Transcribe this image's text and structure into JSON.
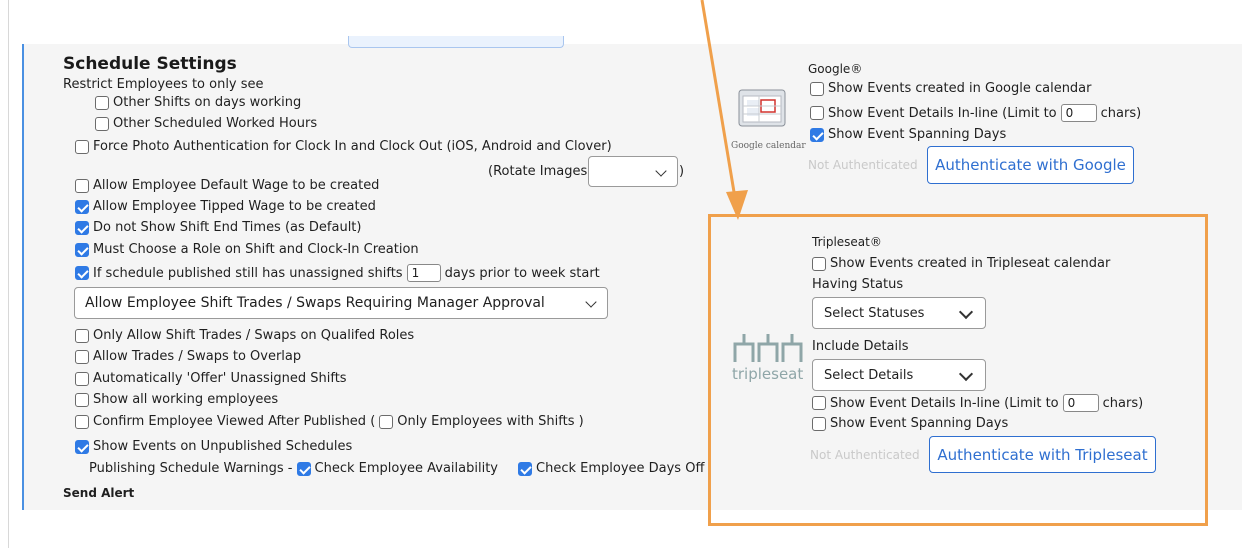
{
  "schedule": {
    "title": "Schedule Settings",
    "restrict_label": "Restrict Employees to only see",
    "other_shifts": "Other Shifts on days working",
    "other_hours": "Other Scheduled Worked Hours",
    "force_photo": "Force Photo Authentication for Clock In and Clock Out (iOS, Android and Clover)",
    "rotate_label": "(Rotate Images",
    "rotate_close": ")",
    "allow_default_wage": "Allow Employee Default Wage to be created",
    "allow_tipped_wage": "Allow Employee Tipped Wage to be created",
    "no_shift_end": "Do not Show Shift End Times (as Default)",
    "must_choose_role": "Must Choose a Role on Shift and Clock-In Creation",
    "unassigned_prefix": "If schedule published still has unassigned shifts",
    "unassigned_days": "1",
    "unassigned_suffix": "days prior to week start",
    "trades_select": "Allow Employee Shift Trades / Swaps Requiring Manager Approval",
    "only_qualified": "Only Allow Shift Trades / Swaps on Qualifed Roles",
    "allow_overlap": "Allow Trades / Swaps to Overlap",
    "auto_offer": "Automatically 'Offer' Unassigned Shifts",
    "show_all_working": "Show all working employees",
    "confirm_viewed": "Confirm Employee Viewed After Published (",
    "only_with_shifts": "Only Employees with Shifts )",
    "show_unpublished": "Show Events on Unpublished Schedules",
    "publishing_warnings": "Publishing Schedule Warnings -",
    "check_availability": "Check Employee Availability",
    "check_days_off": "Check Employee Days Off",
    "send_alert": "Send Alert"
  },
  "google": {
    "title": "Google®",
    "show_events": "Show Events created in Google calendar",
    "details_prefix": "Show Event Details In-line  (Limit to",
    "details_limit": "0",
    "details_suffix": "chars)",
    "spanning": "Show Event Spanning Days",
    "status": "Not Authenticated",
    "auth_button": "Authenticate with Google",
    "logo_caption": "Google calendar"
  },
  "tripleseat": {
    "title": "Tripleseat®",
    "show_events": "Show Events created in Tripleseat calendar",
    "having_status": "Having Status",
    "status_select": "Select Statuses",
    "include_details": "Include Details",
    "details_select": "Select Details",
    "details_prefix": "Show Event Details In-line  (Limit to",
    "details_limit": "0",
    "details_suffix": "chars)",
    "spanning": "Show Event Spanning Days",
    "status": "Not Authenticated",
    "auth_button": "Authenticate with Tripleseat",
    "logo_text": "tripleseat"
  },
  "colors": {
    "accent": "#2f7ae5",
    "highlight": "#f0a04b",
    "tripleseat_logo": "#8fa6a8"
  }
}
